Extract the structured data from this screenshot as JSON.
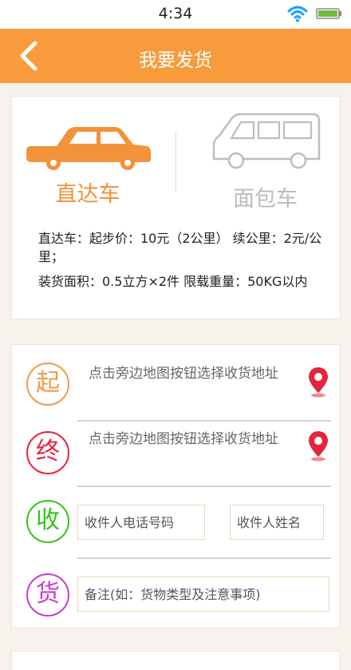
{
  "status_bar": {
    "time": "4:34"
  },
  "nav": {
    "title": "我要发货"
  },
  "vehicles": {
    "options": [
      {
        "label": "直达车",
        "selected": true
      },
      {
        "label": "面包车",
        "selected": false
      }
    ],
    "info_line1": "直达车：起步价：10元（2公里） 续公里：2元/公里；",
    "info_line2": "装货面积：0.5立方×2件 限载重量：50KG以内"
  },
  "form": {
    "start_badge": "起",
    "end_badge": "终",
    "receiver_badge": "收",
    "goods_badge": "货",
    "start_address_hint": "点击旁边地图按钮选择收货地址",
    "end_address_hint": "点击旁边地图按钮选择收货地址",
    "receiver_phone_placeholder": "收件人电话号码",
    "receiver_name_placeholder": "收件人姓名",
    "remark_placeholder": "备注(如：货物类型及注意事项)"
  },
  "colors": {
    "accent": "#f79b3c",
    "start": "#f29a48",
    "end": "#e5243f",
    "receiver": "#36c21a",
    "goods": "#c83bd2",
    "pin": "#e5243f"
  },
  "icons": {
    "back": "chevron-left-icon",
    "wifi": "wifi-icon",
    "battery": "battery-icon",
    "car": "car-icon",
    "van": "van-icon",
    "pin": "map-pin-icon"
  }
}
